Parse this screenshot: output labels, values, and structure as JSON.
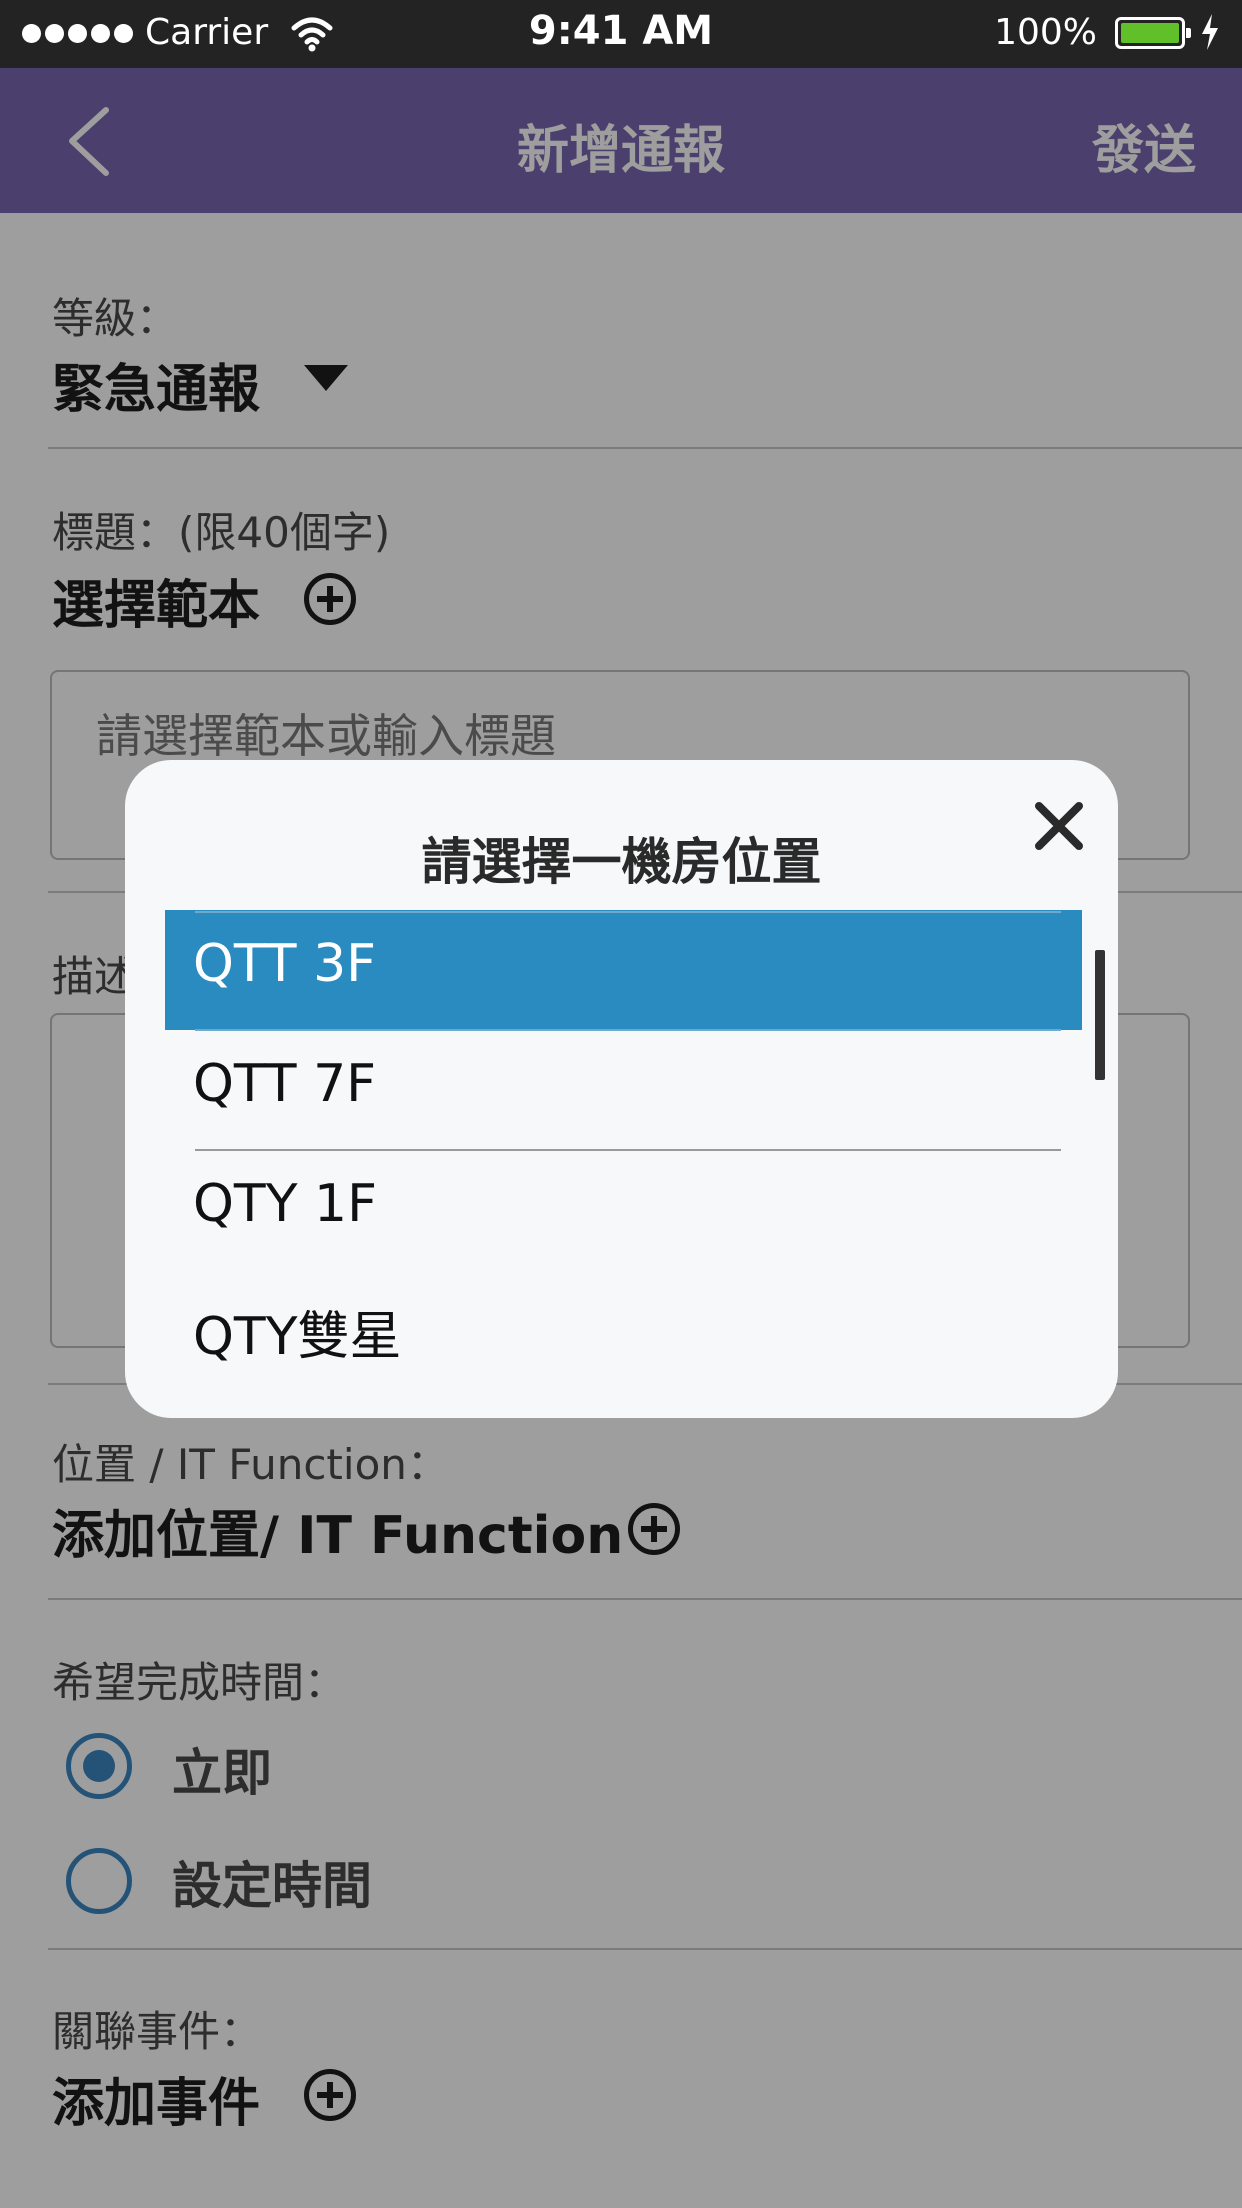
{
  "status_bar": {
    "carrier": "Carrier",
    "time": "9:41 AM",
    "battery": "100%"
  },
  "nav": {
    "title": "新增通報",
    "send_label": "發送"
  },
  "form": {
    "level": {
      "label": "等級：",
      "value": "緊急通報"
    },
    "title_field": {
      "label": "標題：(限40個字)",
      "template_label": "選擇範本",
      "placeholder": "請選擇範本或輸入標題"
    },
    "description": {
      "label": "描述"
    },
    "location": {
      "label": "位置 / IT Function：",
      "add_label": "添加位置/ IT Function"
    },
    "completion": {
      "label": "希望完成時間：",
      "options": [
        {
          "label": "立即",
          "selected": true
        },
        {
          "label": "設定時間",
          "selected": false
        }
      ]
    },
    "related": {
      "label": "關聯事件：",
      "add_label": "添加事件"
    }
  },
  "modal": {
    "title": "請選擇一機房位置",
    "items": [
      {
        "label": "QTT 3F",
        "selected": true
      },
      {
        "label": "QTT 7F",
        "selected": false
      },
      {
        "label": "QTY 1F",
        "selected": false
      },
      {
        "label": "QTY雙星",
        "selected": false
      }
    ]
  },
  "colors": {
    "nav_bg": "#7a66b0",
    "selected_bg": "#2a8bc1",
    "radio": "#3a86c1"
  }
}
